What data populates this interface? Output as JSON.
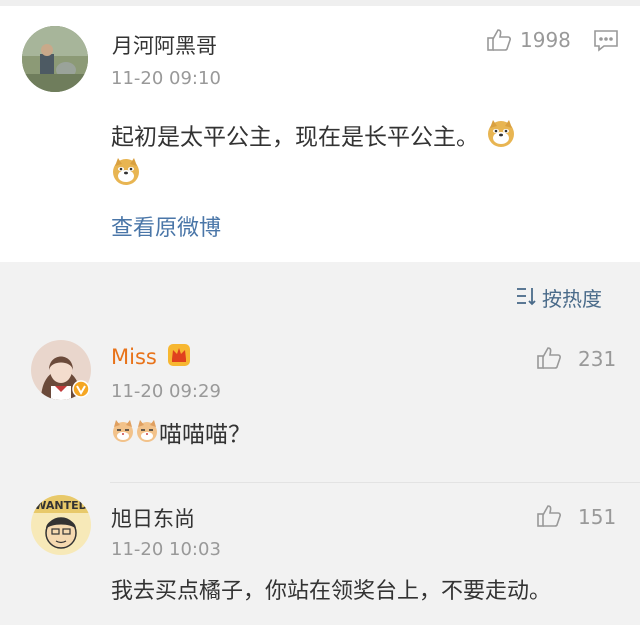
{
  "post": {
    "author": "月河阿黑哥",
    "time": "11-20 09:10",
    "likes": "1998",
    "content_line1": "起初是太平公主，现在是长平公主。",
    "view_original": "查看原微博"
  },
  "sort": {
    "label": "按热度"
  },
  "comments": [
    {
      "author": "Miss",
      "time": "11-20 09:29",
      "likes": "231",
      "text": "喵喵喵？"
    },
    {
      "author": "旭日东尚",
      "time": "11-20 10:03",
      "likes": "151",
      "text": "我去买点橘子，你站在领奖台上，不要走动。"
    }
  ],
  "avatar_text": "WANTED",
  "colors": {
    "link": "#4a76a8",
    "name_orange": "#e8731a",
    "meta": "#999999",
    "bg": "#f2f2f2"
  }
}
